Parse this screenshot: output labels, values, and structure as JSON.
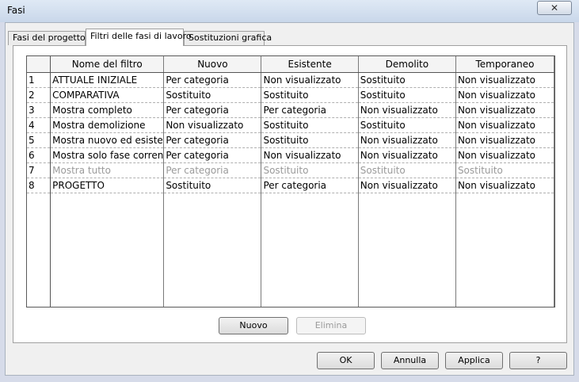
{
  "window": {
    "title": "Fasi",
    "close_label": "✕"
  },
  "tabs": [
    {
      "label": "Fasi del progetto",
      "active": false
    },
    {
      "label": "Filtri delle fasi di lavoro",
      "active": true
    },
    {
      "label": "Sostituzioni grafica",
      "active": false
    }
  ],
  "table": {
    "headers": [
      "Nome del filtro",
      "Nuovo",
      "Esistente",
      "Demolito",
      "Temporaneo"
    ],
    "rows": [
      {
        "num": "1",
        "cells": [
          "ATTUALE INIZIALE",
          "Per categoria",
          "Non visualizzato",
          "Sostituito",
          "Non visualizzato"
        ]
      },
      {
        "num": "2",
        "cells": [
          "COMPARATIVA",
          "Sostituito",
          "Sostituito",
          "Sostituito",
          "Non visualizzato"
        ]
      },
      {
        "num": "3",
        "cells": [
          "Mostra completo",
          "Per categoria",
          "Per categoria",
          "Non visualizzato",
          "Non visualizzato"
        ]
      },
      {
        "num": "4",
        "cells": [
          "Mostra demolizione",
          "Non visualizzato",
          "Sostituito",
          "Sostituito",
          "Non visualizzato"
        ]
      },
      {
        "num": "5",
        "cells": [
          "Mostra nuovo ed esiste",
          "Per categoria",
          "Sostituito",
          "Non visualizzato",
          "Non visualizzato"
        ]
      },
      {
        "num": "6",
        "cells": [
          "Mostra solo fase corren",
          "Per categoria",
          "Non visualizzato",
          "Non visualizzato",
          "Non visualizzato"
        ]
      },
      {
        "num": "7",
        "cells": [
          "Mostra tutto",
          "Per categoria",
          "Sostituito",
          "Sostituito",
          "Sostituito"
        ],
        "disabled": true
      },
      {
        "num": "8",
        "cells": [
          "PROGETTO",
          "Sostituito",
          "Per categoria",
          "Non visualizzato",
          "Non visualizzato"
        ]
      }
    ]
  },
  "buttons": {
    "nuovo": "Nuovo",
    "elimina": "Elimina",
    "ok": "OK",
    "annulla": "Annulla",
    "applica": "Applica",
    "help": "?"
  }
}
